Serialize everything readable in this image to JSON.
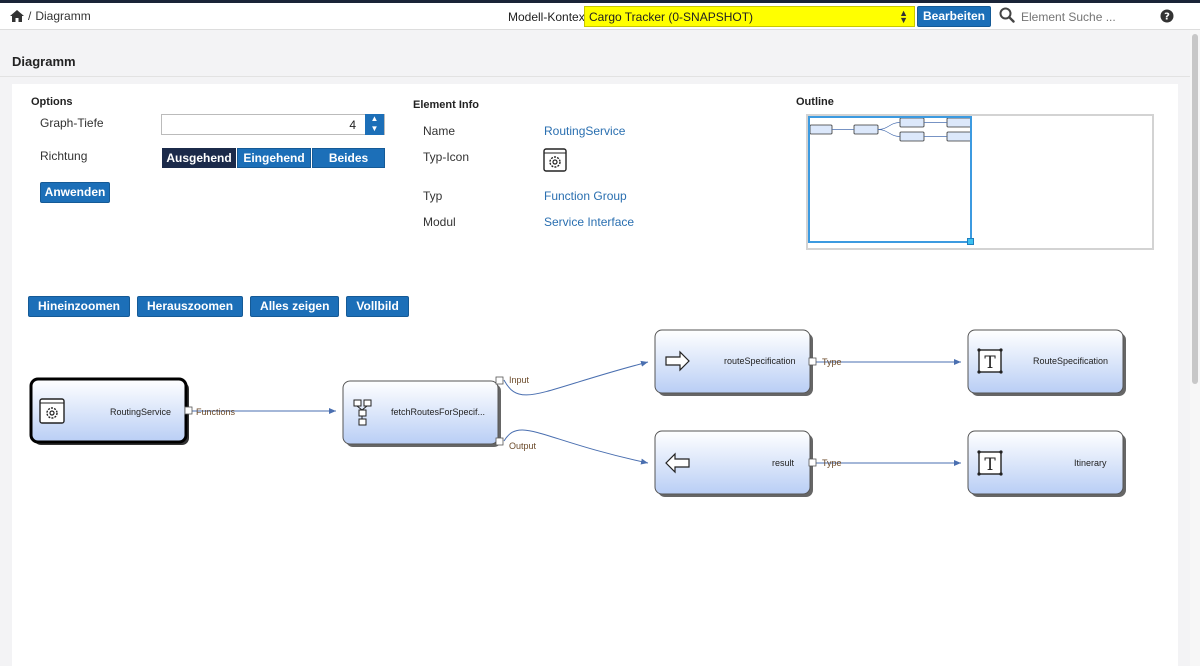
{
  "breadcrumb": {
    "current": "Diagramm",
    "separator": "/"
  },
  "context": {
    "label": "Modell-Kontext:",
    "selected": "Cargo Tracker (0-SNAPSHOT)",
    "edit_button": "Bearbeiten"
  },
  "search": {
    "placeholder": "Element Suche ..."
  },
  "page": {
    "title": "Diagramm"
  },
  "options": {
    "heading": "Options",
    "depth_label": "Graph-Tiefe",
    "depth_value": "4",
    "direction_label": "Richtung",
    "direction_options": [
      "Ausgehend",
      "Eingehend",
      "Beides"
    ],
    "direction_selected": "Ausgehend",
    "apply_button": "Anwenden"
  },
  "element_info": {
    "heading": "Element Info",
    "name_label": "Name",
    "name_value": "RoutingService",
    "icon_label": "Typ-Icon",
    "type_label": "Typ",
    "type_value": "Function Group",
    "module_label": "Modul",
    "module_value": "Service Interface"
  },
  "outline": {
    "heading": "Outline"
  },
  "zoom_toolbar": {
    "zoom_in": "Hineinzoomen",
    "zoom_out": "Herauszoomen",
    "show_all": "Alles zeigen",
    "fullscreen": "Vollbild"
  },
  "diagram": {
    "nodes": {
      "routing_service": "RoutingService",
      "fetch_routes": "fetchRoutesForSpecif...",
      "route_spec_param": "routeSpecification",
      "result_param": "result",
      "route_spec_type": "RouteSpecification",
      "itinerary_type": "Itinerary"
    },
    "edges": {
      "functions": "Functions",
      "input": "Input",
      "output": "Output",
      "type_in": "Type",
      "type_out": "Type"
    }
  },
  "colors": {
    "primary": "#1c6fb8",
    "context_highlight": "#ffff00",
    "selected_segment": "#1b2a4a",
    "link": "#2a6fb0"
  }
}
